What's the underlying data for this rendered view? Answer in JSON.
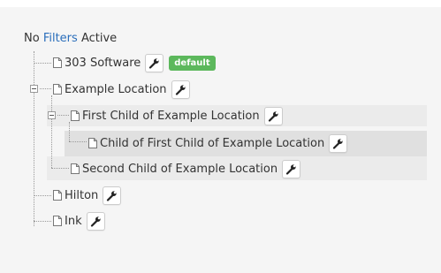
{
  "header": {
    "no_label": "No",
    "filters_link": "Filters",
    "active_label": "Active"
  },
  "tree": {
    "items": [
      {
        "label": "303 Software",
        "badge": "default"
      },
      {
        "label": "Example Location",
        "expanded": true
      },
      {
        "label": "First Child of Example Location",
        "expanded": true
      },
      {
        "label": "Child of First Child of Example Location"
      },
      {
        "label": "Second Child of Example Location"
      },
      {
        "label": "Hilton"
      },
      {
        "label": "Ink"
      }
    ]
  },
  "icons": {
    "toggle": "minus-box-icon",
    "document": "document-icon",
    "action": "wrench-icon"
  },
  "colors": {
    "link": "#2a6ebb",
    "badge": "#5cb85c",
    "panel_background": "#f5f5f5",
    "row_highlight": "#ebebeb",
    "row_selected": "#e0e0e0"
  }
}
